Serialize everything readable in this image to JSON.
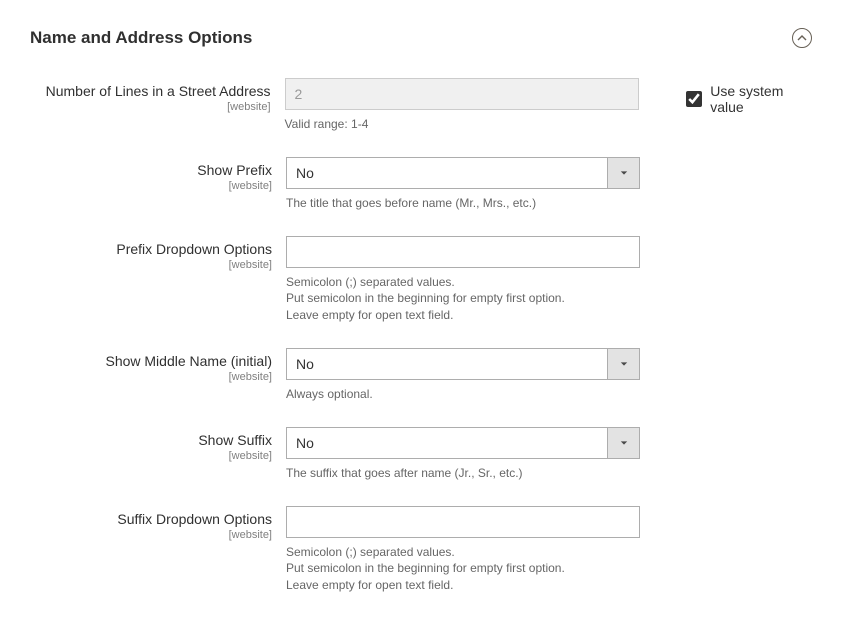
{
  "section": {
    "title": "Name and Address Options"
  },
  "fields": {
    "streetLines": {
      "label": "Number of Lines in a Street Address",
      "scope": "[website]",
      "value": "2",
      "comment": "Valid range: 1-4",
      "useSystem": {
        "label": "Use system value",
        "checked": true
      }
    },
    "showPrefix": {
      "label": "Show Prefix",
      "scope": "[website]",
      "value": "No",
      "comment": "The title that goes before name (Mr., Mrs., etc.)"
    },
    "prefixOptions": {
      "label": "Prefix Dropdown Options",
      "scope": "[website]",
      "value": "",
      "comment": "Semicolon (;) separated values.\nPut semicolon in the beginning for empty first option.\nLeave empty for open text field."
    },
    "showMiddle": {
      "label": "Show Middle Name (initial)",
      "scope": "[website]",
      "value": "No",
      "comment": "Always optional."
    },
    "showSuffix": {
      "label": "Show Suffix",
      "scope": "[website]",
      "value": "No",
      "comment": "The suffix that goes after name (Jr., Sr., etc.)"
    },
    "suffixOptions": {
      "label": "Suffix Dropdown Options",
      "scope": "[website]",
      "value": "",
      "comment": "Semicolon (;) separated values.\nPut semicolon in the beginning for empty first option.\nLeave empty for open text field."
    }
  }
}
